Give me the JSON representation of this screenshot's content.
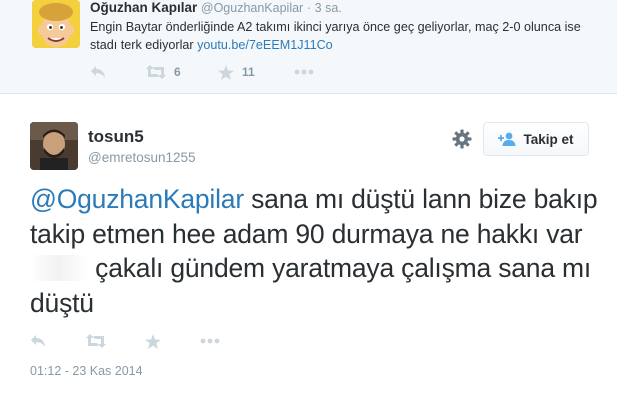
{
  "parent_tweet": {
    "name": "Oğuzhan Kapılar",
    "handle": "@OguzhanKapilar",
    "separator": "·",
    "time": "3 sa.",
    "text": "Engin Baytar önderliğinde A2 takımı ikinci yarıya önce geç geliyorlar, maç 2-0 olunca ise stadı terk ediyorlar ",
    "link": "youtu.be/7eEEM1J11Co",
    "retweet_count": "6",
    "favorite_count": "11"
  },
  "main_tweet": {
    "name": "tosun5",
    "handle": "@emretosun1255",
    "follow_label": "Takip et",
    "mention": "@OguzhanKapilar",
    "text_part1": " sana mı düştü lann bize bakıp takip etmen hee adam 90 durmaya ne hakkı var ",
    "text_part2": " çakalı gündem yaratmaya çalışma sana mı düştü",
    "timestamp": "01:12 - 23 Kas 2014"
  },
  "icons": {
    "reply": "reply-icon",
    "retweet": "retweet-icon",
    "favorite": "star-icon",
    "more": "more-icon",
    "settings": "gear-icon",
    "follow": "add-user-icon"
  },
  "colors": {
    "link": "#2b7bb9",
    "muted": "#8899a6",
    "text": "#292f33",
    "action_icon": "#ccd6dd",
    "parent_bg": "#f5f8fa"
  }
}
